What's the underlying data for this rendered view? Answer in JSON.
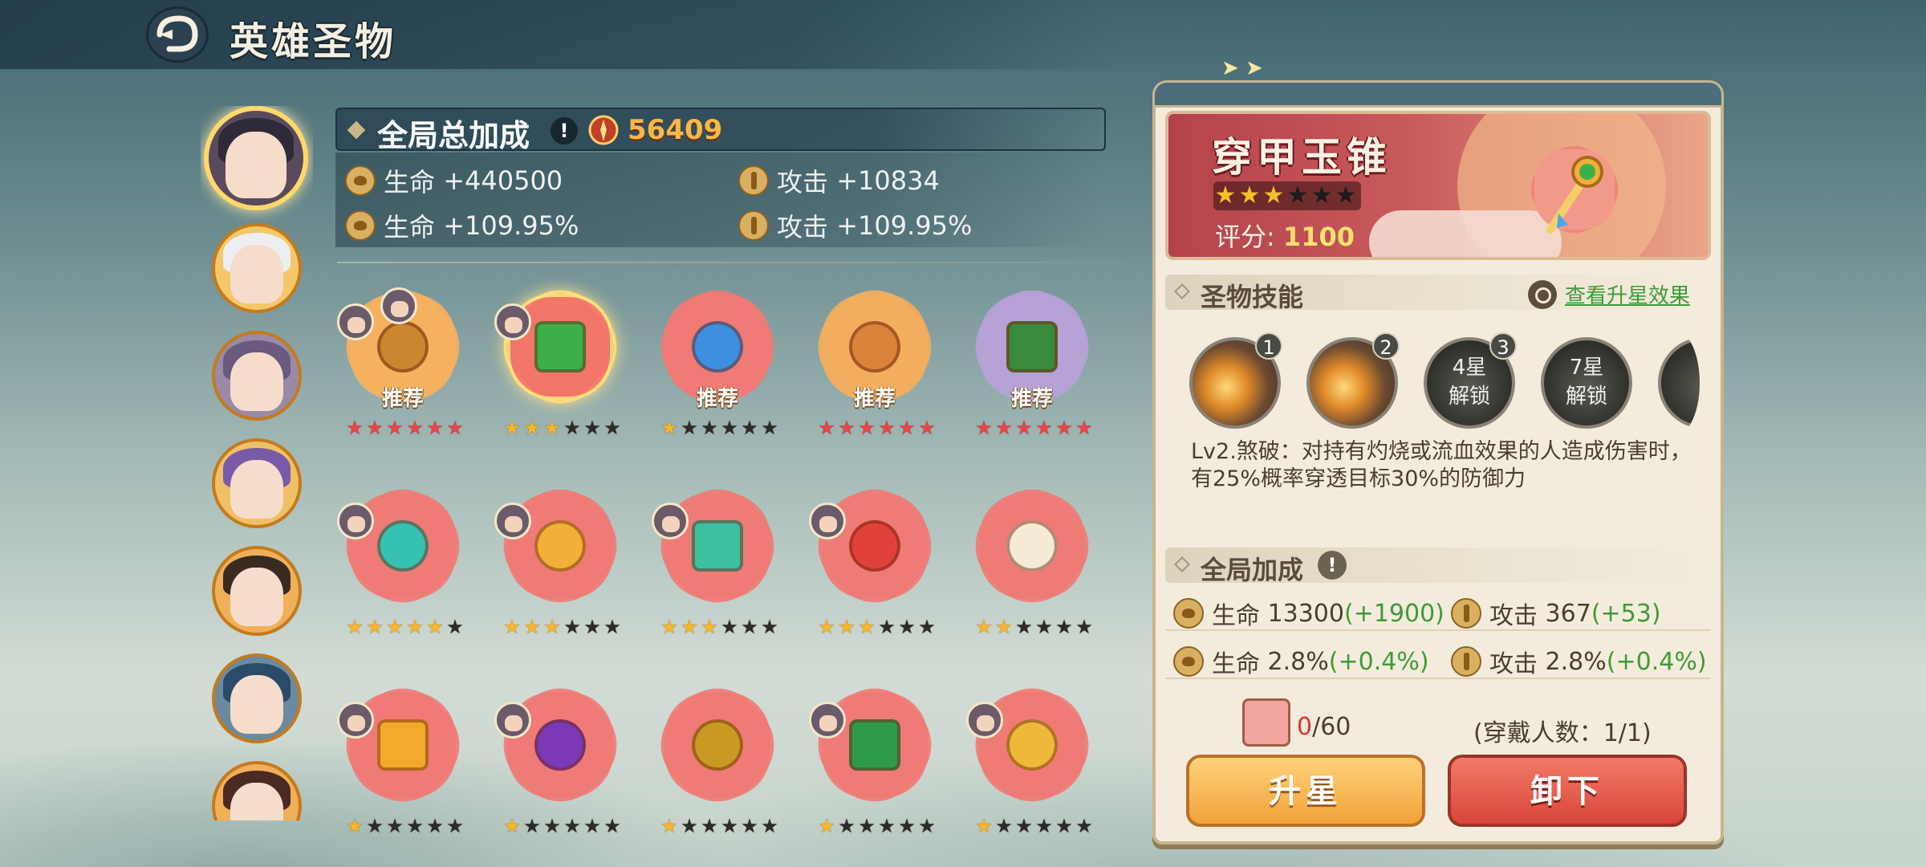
{
  "header": {
    "title": "英雄圣物",
    "back_icon": "back-arrow-icon"
  },
  "global_bonus": {
    "title": "全局总加成",
    "info_glyph": "!",
    "power": "56409",
    "stats": [
      {
        "icon": "hp-icon",
        "label": "生命",
        "value": "+440500"
      },
      {
        "icon": "attack-icon",
        "label": "攻击",
        "value": "+10834"
      },
      {
        "icon": "hp-percent-icon",
        "label": "生命",
        "value": "+109.95%"
      },
      {
        "icon": "attack-percent-icon",
        "label": "攻击",
        "value": "+109.95%"
      }
    ]
  },
  "heroes": [
    {
      "name": "hero-1",
      "hair": "#2e2a3a",
      "bg": "#5a4a5e",
      "selected": true
    },
    {
      "name": "hero-2",
      "hair": "#eeeef2",
      "bg": "#f4c86a",
      "selected": false
    },
    {
      "name": "hero-3",
      "hair": "#6a5a7e",
      "bg": "#9a8aa8",
      "selected": false
    },
    {
      "name": "hero-4",
      "hair": "#7a5aa8",
      "bg": "#f0c068",
      "selected": false
    },
    {
      "name": "hero-5",
      "hair": "#3a2a22",
      "bg": "#f0b05a",
      "selected": false
    },
    {
      "name": "hero-6",
      "hair": "#2a4a6a",
      "bg": "#6a8aa0",
      "selected": false
    },
    {
      "name": "hero-7",
      "hair": "#4a2a22",
      "bg": "#f0b05a",
      "selected": false
    }
  ],
  "relics": [
    {
      "name": "scythe-relic",
      "petal": "#f6b15e",
      "core": "#c9872f",
      "stars": 6,
      "filled_color": "red",
      "recommend": "推荐",
      "avatars": 2,
      "selected": false
    },
    {
      "name": "jade-awl-relic",
      "petal": "#f2756a",
      "core": "#3bb04a",
      "stars": 3,
      "filled_color": "gold",
      "recommend": "",
      "avatars": 1,
      "selected": true
    },
    {
      "name": "orb-staff-relic",
      "petal": "#f07a76",
      "core": "#3d8fe0",
      "stars": 1,
      "filled_color": "gold",
      "recommend": "推荐",
      "avatars": 0,
      "selected": false
    },
    {
      "name": "claw-necklace-relic",
      "petal": "#f4ad5e",
      "core": "#d9843a",
      "stars": 6,
      "filled_color": "red",
      "recommend": "推荐",
      "avatars": 0,
      "selected": false
    },
    {
      "name": "jade-axe-relic",
      "petal": "#b7a2d6",
      "core": "#3a8a3e",
      "stars": 6,
      "filled_color": "red",
      "recommend": "推荐",
      "avatars": 0,
      "selected": false
    },
    {
      "name": "teal-mirror-relic",
      "petal": "#f07a76",
      "core": "#36c2b0",
      "stars": 5,
      "filled_color": "gold",
      "recommend": "",
      "avatars": 1,
      "selected": false
    },
    {
      "name": "golden-scroll-relic",
      "petal": "#f07a76",
      "core": "#f1b03a",
      "stars": 3,
      "filled_color": "gold",
      "recommend": "",
      "avatars": 1,
      "selected": false
    },
    {
      "name": "jade-key-relic",
      "petal": "#f07a76",
      "core": "#3cc0a0",
      "stars": 3,
      "filled_color": "gold",
      "recommend": "",
      "avatars": 1,
      "selected": false
    },
    {
      "name": "phoenix-blade-relic",
      "petal": "#f07a76",
      "core": "#e0423a",
      "stars": 3,
      "filled_color": "gold",
      "recommend": "",
      "avatars": 1,
      "selected": false
    },
    {
      "name": "drum-relic",
      "petal": "#f07a76",
      "core": "#f4ead6",
      "stars": 2,
      "filled_color": "gold",
      "recommend": "",
      "avatars": 0,
      "selected": false
    },
    {
      "name": "golden-disc-relic",
      "petal": "#f07a76",
      "core": "#f2a92a",
      "stars": 1,
      "filled_color": "gold",
      "recommend": "",
      "avatars": 1,
      "selected": false
    },
    {
      "name": "shadow-dagger-relic",
      "petal": "#f07a76",
      "core": "#7a3ab8",
      "stars": 1,
      "filled_color": "gold",
      "recommend": "",
      "avatars": 1,
      "selected": false
    },
    {
      "name": "gold-mask-relic",
      "petal": "#f07a76",
      "core": "#c99a22",
      "stars": 1,
      "filled_color": "gold",
      "recommend": "",
      "avatars": 0,
      "selected": false
    },
    {
      "name": "emerald-leaf-relic",
      "petal": "#f07a76",
      "core": "#2f9a4a",
      "stars": 1,
      "filled_color": "gold",
      "recommend": "",
      "avatars": 1,
      "selected": false
    },
    {
      "name": "golden-bell-relic",
      "petal": "#f07a76",
      "core": "#f0b83a",
      "stars": 1,
      "filled_color": "gold",
      "recommend": "",
      "avatars": 1,
      "selected": false
    }
  ],
  "detail": {
    "name": "穿甲玉锥",
    "stars_filled": 3,
    "stars_total": 6,
    "score_label": "评分:",
    "score": "1100",
    "skills_section": "圣物技能",
    "view_star_link": "查看升星效果",
    "skills": [
      {
        "num": "1",
        "locked": false,
        "label": ""
      },
      {
        "num": "2",
        "locked": false,
        "label": ""
      },
      {
        "num": "3",
        "locked": true,
        "label": "4星\n解锁"
      },
      {
        "num": "",
        "locked": true,
        "label": "7星\n解锁"
      }
    ],
    "skill_desc": "Lv2.煞破：对持有灼烧或流血效果的人造成伤害时，有25%概率穿透目标30%的防御力",
    "global_section": "全局加成",
    "info_glyph": "!",
    "bonus": [
      {
        "label": "生命",
        "value": "13300",
        "plus": "(+1900)"
      },
      {
        "label": "攻击",
        "value": "367",
        "plus": "(+53)"
      },
      {
        "label": "生命",
        "value": "2.8%",
        "plus": "(+0.4%)"
      },
      {
        "label": "攻击",
        "value": "2.8%",
        "plus": "(+0.4%)"
      }
    ],
    "material_have": "0",
    "material_need": "/60",
    "wear_count": "(穿戴人数：1/1)",
    "star_up_btn": "升星",
    "unequip_btn": "卸下"
  },
  "colors": {
    "accent_gold": "#ffb648",
    "green_plus": "#3f9a36",
    "star_red": "#e8444a",
    "star_gold": "#f5b82a"
  }
}
